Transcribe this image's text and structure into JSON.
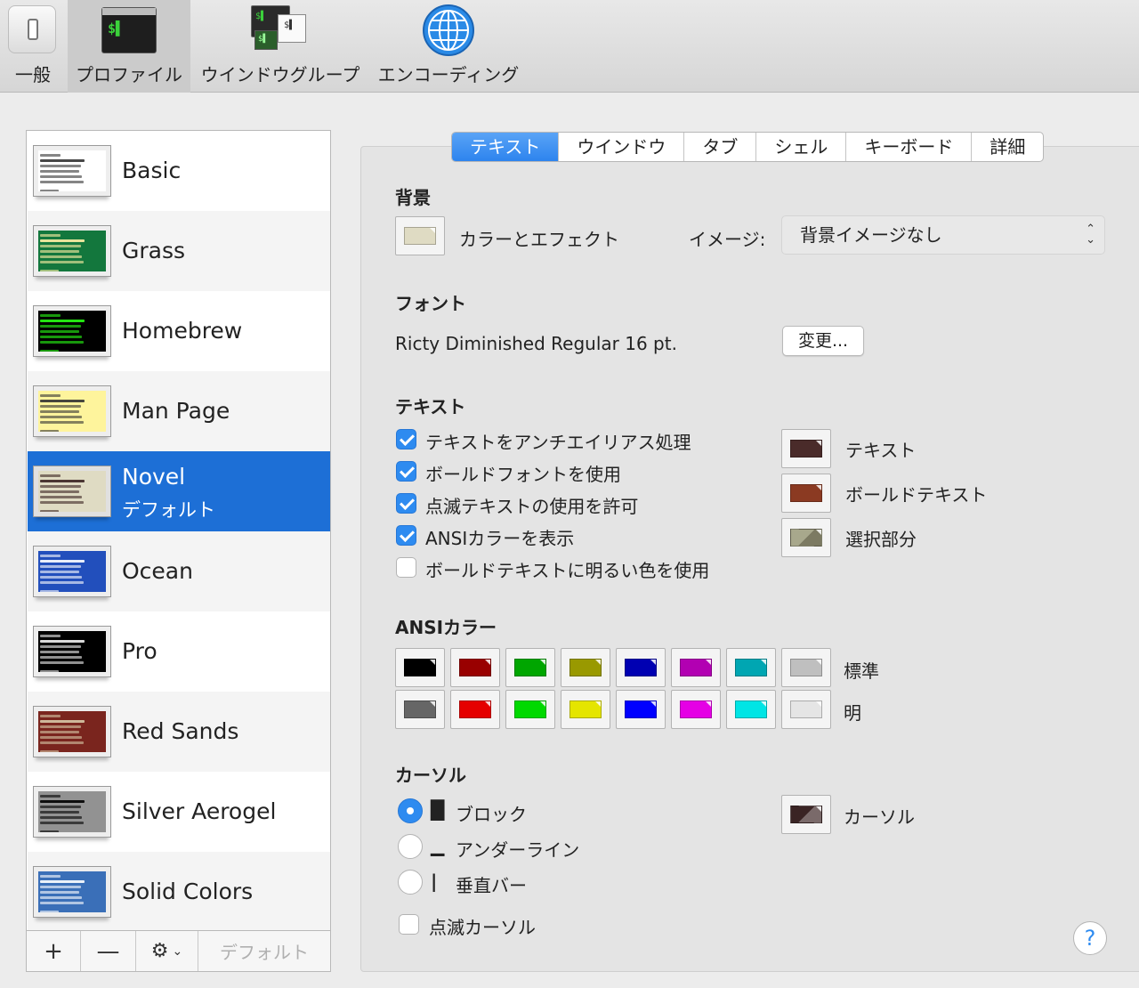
{
  "toolbar": {
    "items": [
      {
        "label": "一般",
        "icon": "switch-icon"
      },
      {
        "label": "プロファイル",
        "icon": "terminal-icon"
      },
      {
        "label": "ウインドウグループ",
        "icon": "window-group-icon"
      },
      {
        "label": "エンコーディング",
        "icon": "globe-icon"
      }
    ],
    "selected": "プロファイル"
  },
  "profiles": [
    {
      "name": "Basic",
      "bg": "#ffffff",
      "fg": "#333333"
    },
    {
      "name": "Grass",
      "bg": "#13773d",
      "fg": "#fff0a5"
    },
    {
      "name": "Homebrew",
      "bg": "#000000",
      "fg": "#28fe14"
    },
    {
      "name": "Man Page",
      "bg": "#fef49c",
      "fg": "#333333"
    },
    {
      "name": "Novel",
      "subtitle": "デフォルト",
      "bg": "#dfdbc3",
      "fg": "#3b2322"
    },
    {
      "name": "Ocean",
      "bg": "#224fbc",
      "fg": "#ffffff"
    },
    {
      "name": "Pro",
      "bg": "#000000",
      "fg": "#f2f2f2"
    },
    {
      "name": "Red Sands",
      "bg": "#7a251e",
      "fg": "#d7c9a7"
    },
    {
      "name": "Silver Aerogel",
      "bg": "#929292",
      "fg": "#000000"
    },
    {
      "name": "Solid Colors",
      "bg": "#3a6fb8",
      "fg": "#ffffff"
    }
  ],
  "sidebar_footer": {
    "add": "+",
    "remove": "—",
    "gear": "⚙",
    "default": "デフォルト"
  },
  "tabs": [
    "テキスト",
    "ウインドウ",
    "タブ",
    "シェル",
    "キーボード",
    "詳細"
  ],
  "active_tab": "テキスト",
  "background": {
    "title": "背景",
    "color_label": "カラーとエフェクト",
    "color": "#dfdbc3",
    "image_label": "イメージ:",
    "image_value": "背景イメージなし"
  },
  "font": {
    "title": "フォント",
    "value": "Ricty Diminished Regular 16 pt.",
    "change_button": "変更..."
  },
  "text": {
    "title": "テキスト",
    "options": [
      {
        "label": "テキストをアンチエイリアス処理",
        "checked": true
      },
      {
        "label": "ボールドフォントを使用",
        "checked": true
      },
      {
        "label": "点滅テキストの使用を許可",
        "checked": true
      },
      {
        "label": "ANSIカラーを表示",
        "checked": true
      },
      {
        "label": "ボールドテキストに明るい色を使用",
        "checked": false
      }
    ],
    "colors": [
      {
        "label": "テキスト",
        "color": "#4a2b2a"
      },
      {
        "label": "ボールドテキスト",
        "color": "#8b3a22"
      },
      {
        "label": "選択部分",
        "color": "#7c7a62"
      }
    ]
  },
  "ansi": {
    "title": "ANSIカラー",
    "normal_label": "標準",
    "bright_label": "明",
    "normal": [
      "#000000",
      "#990000",
      "#00a600",
      "#999900",
      "#0000b2",
      "#b200b2",
      "#00a6b2",
      "#bfbfbf"
    ],
    "bright": [
      "#666666",
      "#e50000",
      "#00d900",
      "#e5e500",
      "#0000ff",
      "#e500e5",
      "#00e5e5",
      "#e5e5e5"
    ]
  },
  "cursor": {
    "title": "カーソル",
    "options": [
      {
        "glyph": "█",
        "label": "ブロック",
        "selected": true
      },
      {
        "glyph": "▁",
        "label": "アンダーライン",
        "selected": false
      },
      {
        "glyph": "|",
        "label": "垂直バー",
        "selected": false
      }
    ],
    "blink_label": "点滅カーソル",
    "blink": false,
    "color_label": "カーソル",
    "color": "#3a2424"
  },
  "help": "?"
}
